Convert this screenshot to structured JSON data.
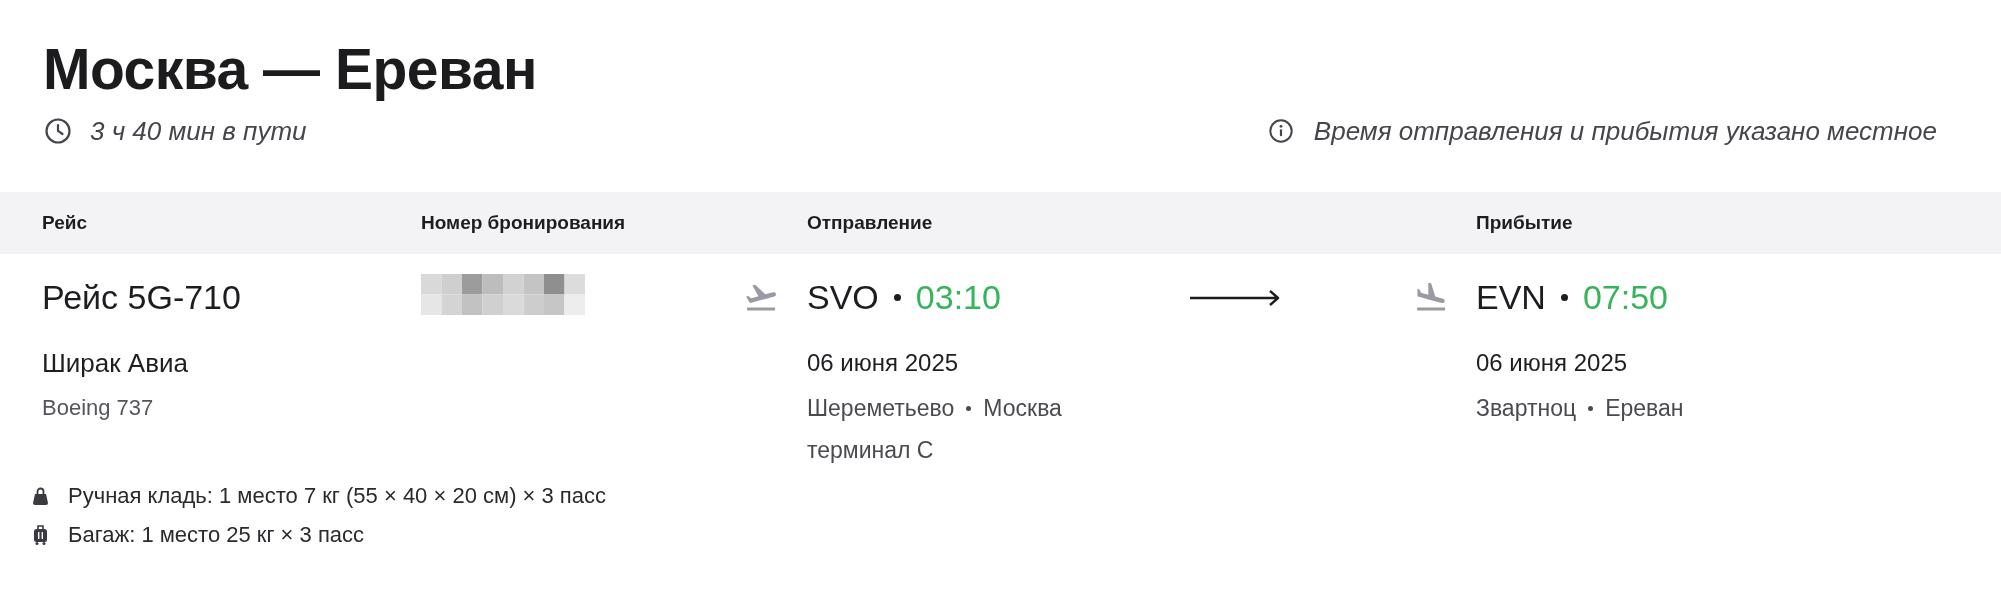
{
  "title": "Москва — Ереван",
  "duration": "3 ч 40 мин в пути",
  "time_note": "Время отправления и прибытия указано местное",
  "table": {
    "columns": [
      "Рейс",
      "Номер бронирования",
      "Отправление",
      "Прибытие"
    ],
    "flight": {
      "number": "Рейс 5G-710",
      "airline": "Ширак Авиа",
      "aircraft": "Boeing 737"
    },
    "departure": {
      "airport_code": "SVO",
      "time": "03:10",
      "date": "06 июня 2025",
      "airport": "Шереметьево",
      "city": "Москва",
      "terminal": "терминал C"
    },
    "arrival": {
      "airport_code": "EVN",
      "time": "07:50",
      "date": "06 июня 2025",
      "airport": "Звартноц",
      "city": "Ереван"
    }
  },
  "baggage": [
    {
      "kind": "hand",
      "text": "Ручная кладь: 1 место 7 кг (55 × 40 × 20 см) × 3 пасс"
    },
    {
      "kind": "checked",
      "text": "Багаж: 1 место 25 кг × 3 пасс"
    }
  ]
}
